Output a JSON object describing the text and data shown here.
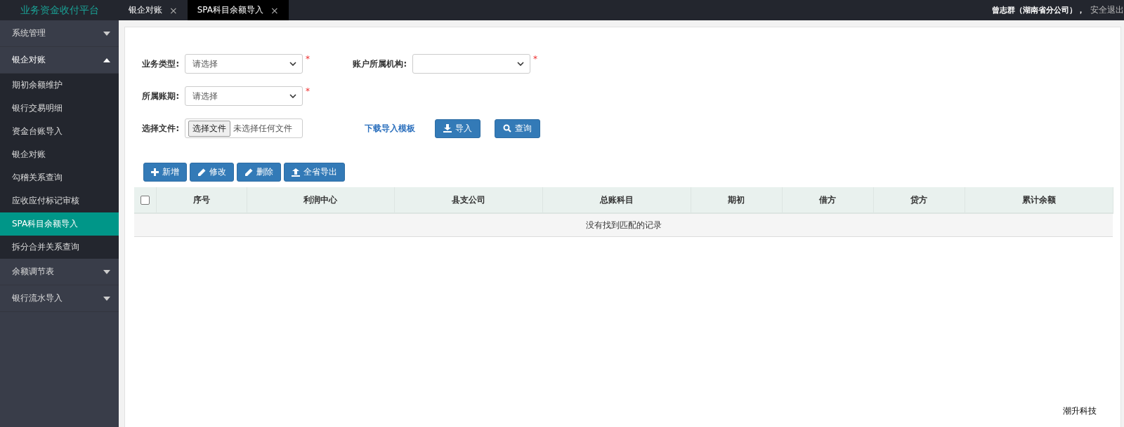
{
  "topbar": {
    "brand": "业务资金收付平台",
    "tabs": [
      {
        "label": "银企对账",
        "close": "×",
        "selected": false
      },
      {
        "label": "SPA科目余额导入",
        "close": "×",
        "selected": true
      }
    ],
    "user": "曾志群（湖南省分公司），",
    "logout": "安全退出"
  },
  "sidebar": {
    "groups": [
      {
        "label": "系统管理",
        "expanded": false
      },
      {
        "label": "银企对账",
        "expanded": true,
        "children": [
          {
            "label": "期初余额维护",
            "selected": false
          },
          {
            "label": "银行交易明细",
            "selected": false
          },
          {
            "label": "资金台账导入",
            "selected": false
          },
          {
            "label": "银企对账",
            "selected": false
          },
          {
            "label": "勾稽关系查询",
            "selected": false
          },
          {
            "label": "应收应付标记审核",
            "selected": false
          },
          {
            "label": "SPA科目余额导入",
            "selected": true
          },
          {
            "label": "拆分合并关系查询",
            "selected": false
          }
        ]
      },
      {
        "label": "余额调节表",
        "expanded": false
      },
      {
        "label": "银行流水导入",
        "expanded": false
      }
    ]
  },
  "form": {
    "rows": [
      {
        "fields": [
          {
            "kind": "select",
            "label": "业务类型:",
            "value": "请选择",
            "required_mark": "*"
          },
          {
            "kind": "select",
            "label": "账户所属机构:",
            "required_mark": "*"
          }
        ]
      },
      {
        "fields": [
          {
            "kind": "select",
            "label": "所属账期:",
            "value": "请选择",
            "required_mark": "*"
          }
        ]
      },
      {
        "fields": [
          {
            "kind": "file",
            "label": "选择文件:",
            "button": "选择文件",
            "value": "未选择任何文件"
          }
        ]
      }
    ],
    "link": "下载导入模板",
    "buttons": [
      {
        "kind": "import",
        "label": "导入"
      },
      {
        "kind": "query",
        "label": "查询"
      }
    ]
  },
  "toolbar": [
    {
      "kind": "add",
      "label": "新增"
    },
    {
      "kind": "edit",
      "label": "修改"
    },
    {
      "kind": "delete",
      "label": "删除"
    },
    {
      "kind": "export",
      "label": "全省导出"
    }
  ],
  "table": {
    "select_all_checked": false,
    "columns": [
      "序号",
      "利润中心",
      "县支公司",
      "总账科目",
      "期初",
      "借方",
      "贷方",
      "累计余额"
    ],
    "empty_message": "没有找到匹配的记录"
  },
  "footer": "潮升科技"
}
